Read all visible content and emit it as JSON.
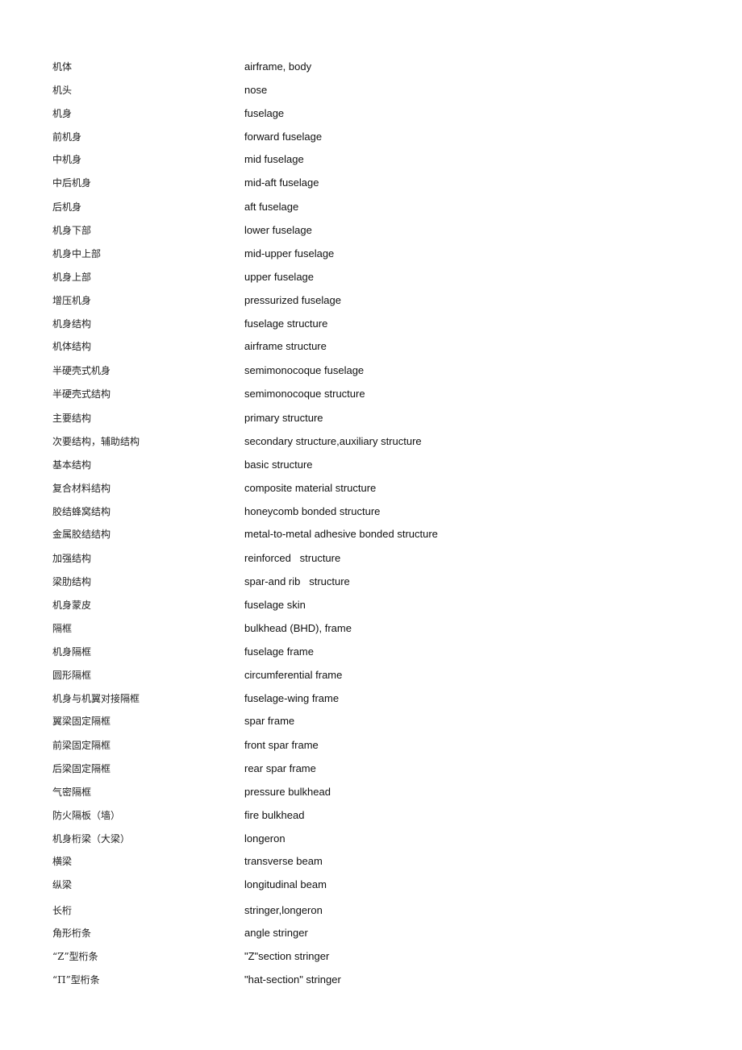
{
  "glossary": [
    {
      "zh": "机体",
      "en": "airframe, body"
    },
    {
      "zh": "机头",
      "en": "nose"
    },
    {
      "zh": "机身",
      "en": "fuselage"
    },
    {
      "zh": "前机身",
      "en": "forward fuselage"
    },
    {
      "zh": "中机身",
      "en": "mid fuselage"
    },
    {
      "zh": "中后机身",
      "en": "mid-aft fuselage"
    },
    {
      "zh": "后机身",
      "en": "aft fuselage"
    },
    {
      "zh": "机身下部",
      "en": "lower fuselage"
    },
    {
      "zh": "机身中上部",
      "en": "mid-upper fuselage"
    },
    {
      "zh": "机身上部",
      "en": "upper fuselage"
    },
    {
      "zh": "增压机身",
      "en": "pressurized fuselage"
    },
    {
      "zh": "机身结构",
      "en": "fuselage structure"
    },
    {
      "zh": "机体结构",
      "en": "airframe structure"
    },
    {
      "zh": "半硬壳式机身",
      "en": "semimonocoque fuselage"
    },
    {
      "zh": "半硬壳式结构",
      "en": "semimonocoque structure"
    },
    {
      "zh": "主要结构",
      "en": "primary structure"
    },
    {
      "zh": "次要结构，辅助结构",
      "en": "secondary structure,auxiliary structure"
    },
    {
      "zh": "基本结构",
      "en": "basic structure"
    },
    {
      "zh": "复合材料结构",
      "en": "composite material structure"
    },
    {
      "zh": "胶结蜂窝结构",
      "en": "honeycomb bonded structure"
    },
    {
      "zh": "金属胶结结构",
      "en": "metal-to-metal adhesive bonded structure"
    },
    {
      "zh": "加强结构",
      "en": "reinforced   structure"
    },
    {
      "zh": "梁肋结构",
      "en": "spar-and rib   structure"
    },
    {
      "zh": "机身蒙皮",
      "en": "fuselage skin"
    },
    {
      "zh": "隔框",
      "en": "bulkhead (BHD), frame"
    },
    {
      "zh": "机身隔框",
      "en": "fuselage frame"
    },
    {
      "zh": "圆形隔框",
      "en": "circumferential frame"
    },
    {
      "zh": "机身与机翼对接隔框",
      "en": "fuselage-wing frame"
    },
    {
      "zh": "翼梁固定隔框",
      "en": "spar frame"
    },
    {
      "zh": "前梁固定隔框",
      "en": "front spar frame"
    },
    {
      "zh": "后梁固定隔框",
      "en": "rear spar frame"
    },
    {
      "zh": "气密隔框",
      "en": "pressure bulkhead"
    },
    {
      "zh": "防火隔板（墙）",
      "en": "fire bulkhead"
    },
    {
      "zh": "机身桁梁（大梁）",
      "en": "longeron"
    },
    {
      "zh": "横梁",
      "en": "transverse beam"
    },
    {
      "zh": "纵梁",
      "en": "longitudinal beam"
    },
    {
      "zh": "长桁",
      "en": "stringer,longeron"
    },
    {
      "zh": "角形桁条",
      "en": "angle stringer"
    },
    {
      "zh": "“Z”型桁条",
      "en": "\"Z\"section stringer"
    },
    {
      "zh": "“П”型桁条",
      "en": "\"hat-section\" stringer"
    }
  ]
}
